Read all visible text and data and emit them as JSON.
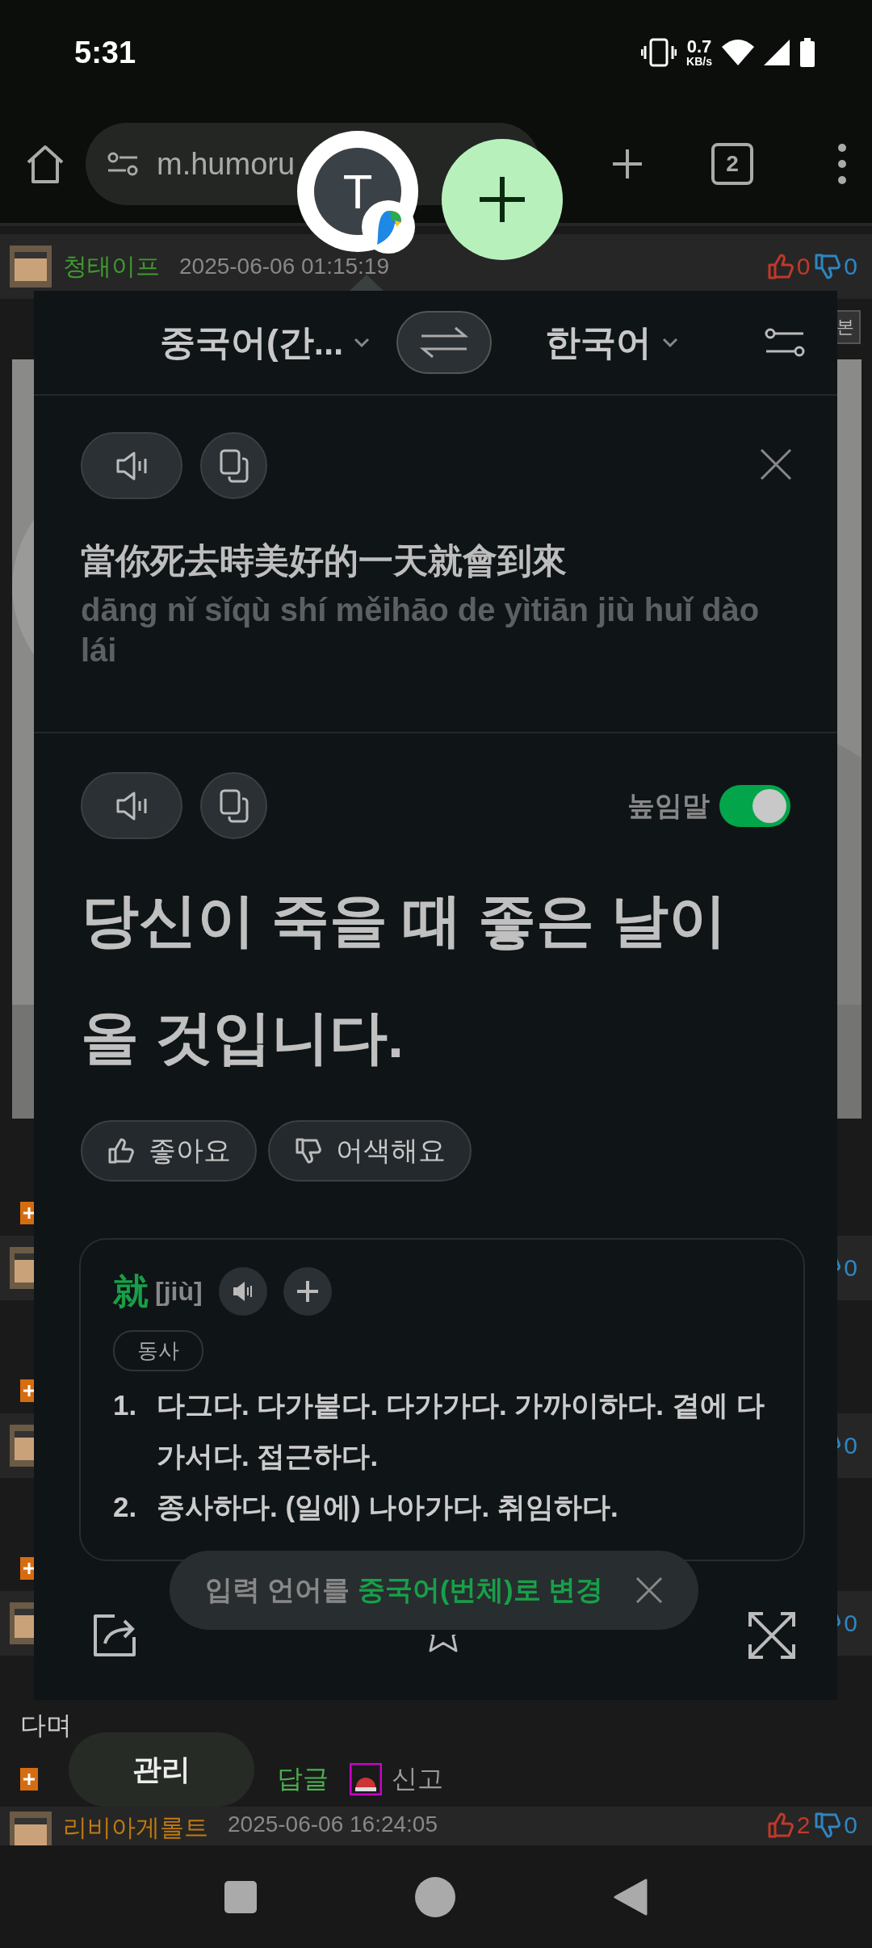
{
  "status_bar": {
    "time": "5:31",
    "net_speed": "0.7",
    "net_unit": "KB/s"
  },
  "browser": {
    "url": "m.humoru",
    "tab_count": "2"
  },
  "comments": [
    {
      "author": "청태이프",
      "color": "#3f9a2e",
      "date": "2025-06-06 01:15:19",
      "up": "0",
      "down": "0",
      "button": "본",
      "kind": "post"
    },
    {
      "down": "0",
      "kind": "header"
    },
    {
      "down": "0",
      "kind": "header"
    },
    {
      "down": "0",
      "kind": "header",
      "body": "다며",
      "actions": [
        "답글",
        "신고"
      ]
    },
    {
      "author": "리비아게롤트",
      "color": "#c07a10",
      "date": "2025-06-06 16:24:05",
      "up": "2",
      "down": "0",
      "kind": "last"
    }
  ],
  "manage_button": "관리",
  "chat_head": {
    "initial": "T"
  },
  "translator": {
    "source_lang": "중국어(간...",
    "target_lang": "한국어",
    "source_text": "當你死去時美好的一天就會到來",
    "pinyin": "dāng nǐ sǐqù shí měihāo de yìtiān jiù huǐ dào lái",
    "honorific": {
      "label": "높임말",
      "on": true
    },
    "translation": "당신이 죽을 때 좋은 날이 올 것입니다.",
    "feedback": [
      "좋아요",
      "어색해요"
    ],
    "dictionary": {
      "headword": "就",
      "reading": "[jiù]",
      "pos": "동사",
      "definitions": [
        {
          "number": "1.",
          "text": "다그다. 다가붙다. 다가가다. 가까이하다. 곁에 다가서다. 접근하다."
        },
        {
          "number": "2.",
          "text": "종사하다. (일에) 나아가다. 취임하다."
        }
      ]
    },
    "toast": {
      "text": "입력 언어를",
      "highlight": "중국어(번체)로 변경"
    }
  }
}
